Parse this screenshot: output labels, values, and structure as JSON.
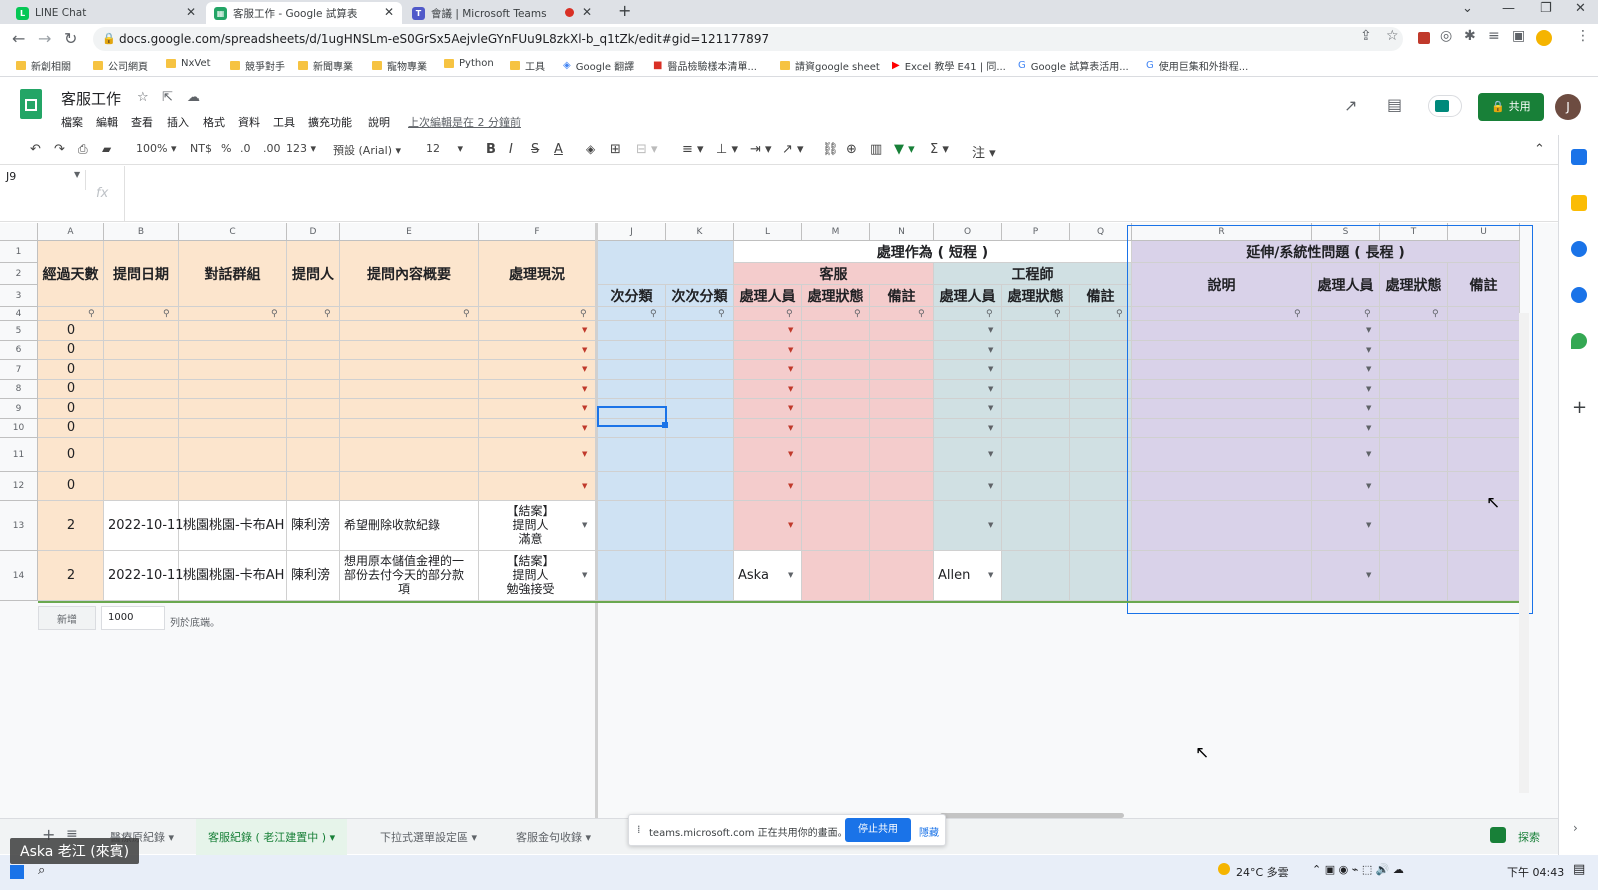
{
  "browser": {
    "tabs": [
      {
        "title": "LINE Chat",
        "icon": "line-icon"
      },
      {
        "title": "客服工作 - Google 試算表",
        "icon": "sheets-icon",
        "active": true
      },
      {
        "title": "會議 | Microsoft Teams",
        "icon": "teams-icon"
      }
    ],
    "new_tab": "+",
    "url": "docs.google.com/spreadsheets/d/1ugHNSLm-eS0GrSx5AejvleGYnFUu9L8zkXl-b_q1tZk/edit#gid=121177897",
    "bookmarks": [
      "新創相關",
      "公司網頁",
      "NxVet",
      "競爭對手",
      "新聞專業",
      "寵物專業",
      "Python",
      "工具",
      "Google 翻譯",
      "醫品檢驗樣本清單...",
      "請資google sheet",
      "Excel 教學 E41 | 同...",
      "Google 試算表活用...",
      "使用巨集和外掛程..."
    ]
  },
  "app": {
    "doc_title": "客服工作",
    "menu": [
      "檔案",
      "編輯",
      "查看",
      "插入",
      "格式",
      "資料",
      "工具",
      "擴充功能",
      "說明"
    ],
    "last_edit": "上次編輯是在 2 分鐘前",
    "share_label": "共用",
    "avatar_letter": "J"
  },
  "toolbar": {
    "zoom": "100%",
    "currency": "NT$",
    "percent": "%",
    "dec_decrease": ".0",
    "dec_increase": ".00",
    "format_more": "123",
    "font": "預設 (Arial)",
    "font_size": "12"
  },
  "formula_bar": {
    "cell_ref": "J9",
    "fx": "fx"
  },
  "sheet": {
    "columns": [
      "A",
      "B",
      "C",
      "D",
      "E",
      "F",
      "J",
      "K",
      "L",
      "M",
      "N",
      "O",
      "P",
      "Q",
      "R",
      "S",
      "T",
      "U"
    ],
    "row_numbers": [
      "1",
      "2",
      "3",
      "4",
      "5",
      "6",
      "7",
      "8",
      "9",
      "10",
      "11",
      "12",
      "13",
      "14"
    ],
    "group_headers": {
      "short_term": "處理作為 ( 短程 )",
      "long_term": "延伸/系統性問題 ( 長程 )",
      "cs": "客服",
      "eng": "工程師"
    },
    "headers": {
      "A": "經過天數",
      "B": "提問日期",
      "C": "對話群組",
      "D": "提問人",
      "E": "提問內容概要",
      "F": "處理現況",
      "J": "次分類",
      "K": "次次分類",
      "L": "處理人員",
      "M": "處理狀態",
      "N": "備註",
      "O": "處理人員",
      "P": "處理狀態",
      "Q": "備註",
      "R": "說明",
      "S": "處理人員",
      "T": "處理狀態",
      "U": "備註"
    },
    "rows": [
      {
        "A": "0"
      },
      {
        "A": "0"
      },
      {
        "A": "0"
      },
      {
        "A": "0"
      },
      {
        "A": "0"
      },
      {
        "A": "0"
      },
      {
        "A": "0"
      },
      {
        "A": "0"
      },
      {
        "A": "2",
        "B": "2022-10-11",
        "C": "桃園桃園-卡布AH",
        "D": "陳利滂",
        "E": "希望刪除收款紀錄",
        "F": "【結案】\n提問人\n滿意"
      },
      {
        "A": "2",
        "B": "2022-10-11",
        "C": "桃園桃園-卡布AH",
        "D": "陳利滂",
        "E": "想用原本儲值金裡的一\n部份去付今天的部分款\n項",
        "F": "【結案】\n提問人\n勉強接受",
        "L": "Aska",
        "O": "Allen"
      }
    ],
    "add_label": "新增",
    "add_rows": "1000",
    "add_suffix": "列於底端。"
  },
  "sheet_tabs": [
    "醫療原紀錄",
    "客服紀錄 ( 老江建置中 )",
    "下拉式選單設定區",
    "客服金句收錄"
  ],
  "explore_label": "探索",
  "share_popup": {
    "text": "teams.microsoft.com 正在共用你的畫面。",
    "stop": "停止共用",
    "hide": "隱藏"
  },
  "presenter_name": "Aska 老江 (來賓)",
  "taskbar": {
    "weather": "24°C 多雲",
    "time": "下午 04:43"
  },
  "colors": {
    "orange": "#fce5cd",
    "blue": "#cfe2f3",
    "pink": "#f4cccc",
    "teal": "#d0e0e3",
    "purple": "#d9d2e9",
    "green": "#188038"
  }
}
